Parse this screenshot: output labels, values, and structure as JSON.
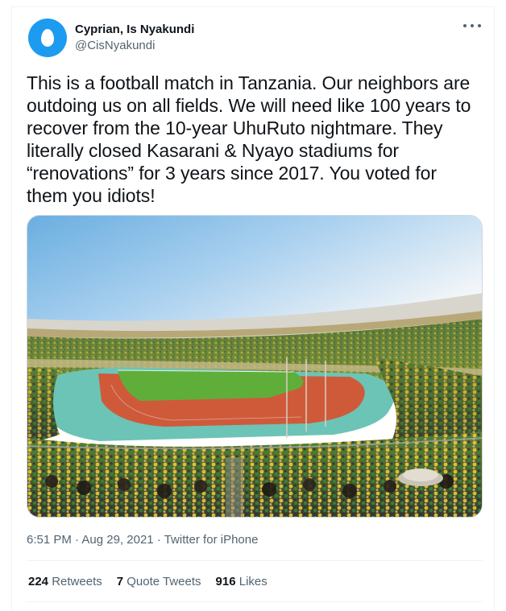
{
  "author": {
    "display_name": "Cyprian, Is Nyakundi",
    "handle": "@CisNyakundi",
    "avatar_icon": "default-egg-avatar",
    "avatar_color": "#1d9bf0"
  },
  "menu_icon": "more-options-icon",
  "tweet": {
    "text": "This is a football match in Tanzania. Our neighbors are\noutdoing us on all fields. We will need like 100 years to\nrecover from the 10-year UhuRuto nightmare. They\nliterally closed Kasarani & Nyayo stadiums for\n“renovations” for 3 years since 2017. You voted for\nthem you idiots!"
  },
  "media": {
    "type": "photo",
    "subject": "football-stadium-photo"
  },
  "meta": {
    "time": "6:51 PM",
    "separator": "·",
    "date": "Aug 29, 2021",
    "source": "Twitter for iPhone"
  },
  "stats": {
    "retweets_count": "224",
    "retweets_label": "Retweets",
    "quotes_count": "7",
    "quotes_label": "Quote Tweets",
    "likes_count": "916",
    "likes_label": "Likes"
  },
  "colors": {
    "text_primary": "#0f1419",
    "text_secondary": "#536471",
    "border": "#eff3f4"
  }
}
